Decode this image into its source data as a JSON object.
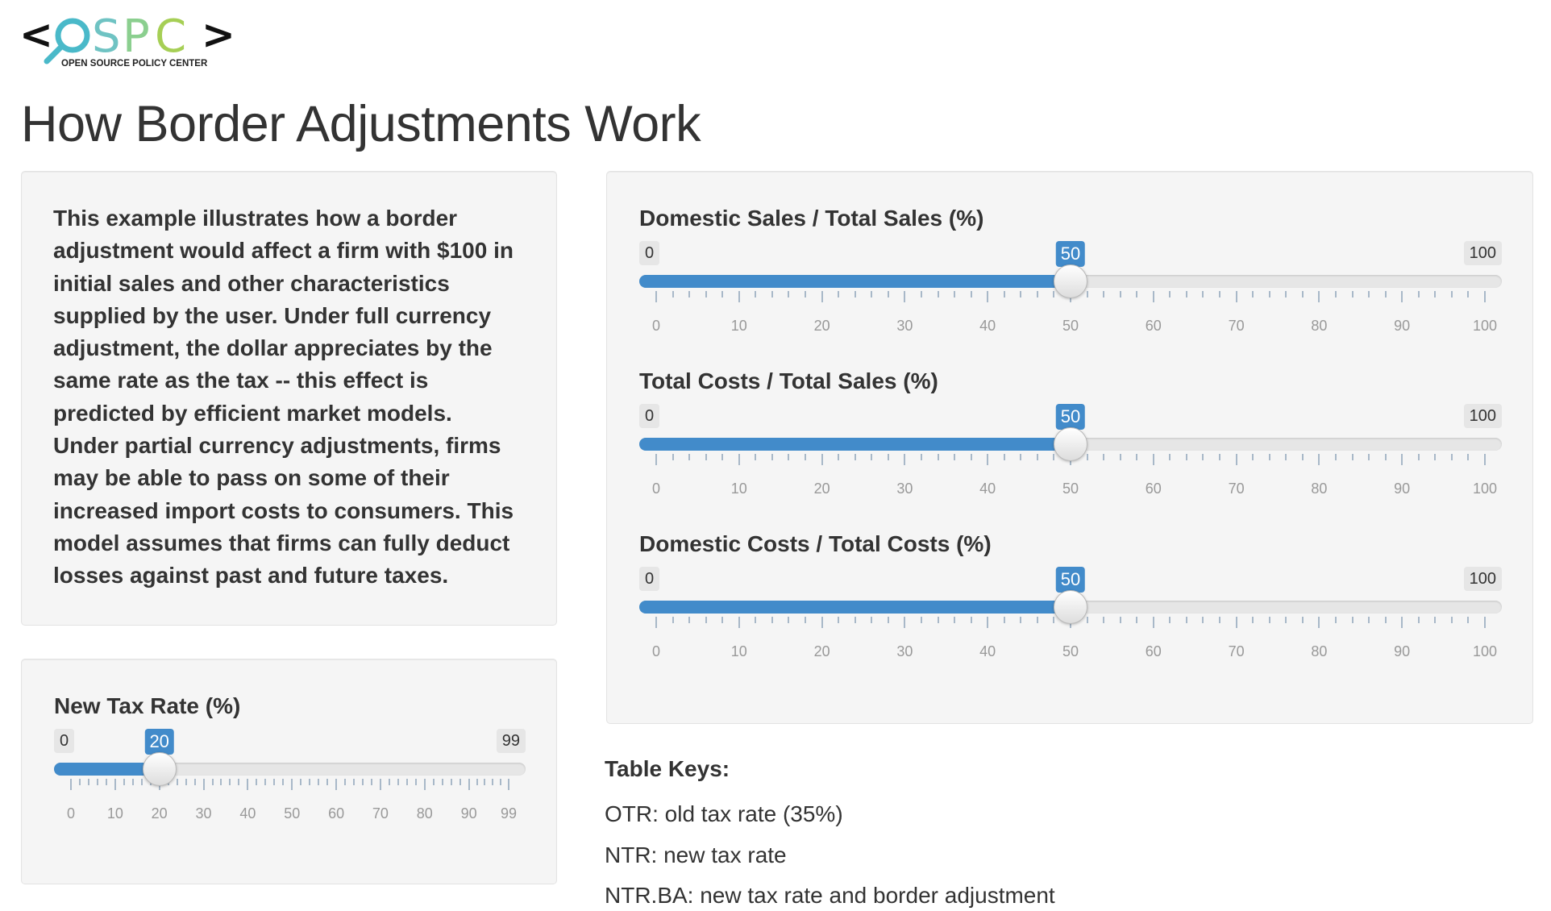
{
  "logo": {
    "name": "OSPC",
    "tagline": "OPEN SOURCE POLICY CENTER",
    "colors": {
      "bracket": "#111111",
      "o": "#4ab9c9",
      "s": "#6fc3c3",
      "p": "#8bcf8f",
      "c": "#a6cf55"
    }
  },
  "page_title": "How Border Adjustments Work",
  "intro": {
    "lines": [
      "This example illustrates how a border",
      "adjustment would affect a firm with $100 in",
      "initial sales and other characteristics",
      "supplied by the user. Under full currency",
      "adjustment, the dollar appreciates by the",
      "same rate as the tax -- this effect is",
      "predicted by efficient market models.",
      "Under partial currency adjustments, firms",
      "may be able to pass on some of their",
      "increased import costs to consumers. This",
      "model assumes that firms can fully deduct",
      "losses against past and future taxes."
    ]
  },
  "sliders": {
    "tax_rate": {
      "label": "New Tax Rate (%)",
      "min": 0,
      "max": 99,
      "value": 20,
      "min_label": "0",
      "max_label": "99",
      "value_label": "20",
      "ticks": [
        "0",
        "10",
        "20",
        "30",
        "40",
        "50",
        "60",
        "70",
        "80",
        "90",
        "99"
      ]
    },
    "domestic_sales": {
      "label": "Domestic Sales / Total Sales (%)",
      "min": 0,
      "max": 100,
      "value": 50,
      "min_label": "0",
      "max_label": "100",
      "value_label": "50",
      "ticks": [
        "0",
        "10",
        "20",
        "30",
        "40",
        "50",
        "60",
        "70",
        "80",
        "90",
        "100"
      ]
    },
    "total_costs": {
      "label": "Total Costs / Total Sales (%)",
      "min": 0,
      "max": 100,
      "value": 50,
      "min_label": "0",
      "max_label": "100",
      "value_label": "50",
      "ticks": [
        "0",
        "10",
        "20",
        "30",
        "40",
        "50",
        "60",
        "70",
        "80",
        "90",
        "100"
      ]
    },
    "domestic_costs": {
      "label": "Domestic Costs / Total Costs (%)",
      "min": 0,
      "max": 100,
      "value": 50,
      "min_label": "0",
      "max_label": "100",
      "value_label": "50",
      "ticks": [
        "0",
        "10",
        "20",
        "30",
        "40",
        "50",
        "60",
        "70",
        "80",
        "90",
        "100"
      ]
    }
  },
  "table_keys": {
    "title": "Table Keys:",
    "lines": [
      "OTR: old tax rate (35%)",
      "NTR: new tax rate",
      "NTR.BA: new tax rate and border adjustment"
    ]
  },
  "colors": {
    "accent": "#428bca",
    "well_bg": "#f5f5f5",
    "track": "#e6e6e6"
  }
}
